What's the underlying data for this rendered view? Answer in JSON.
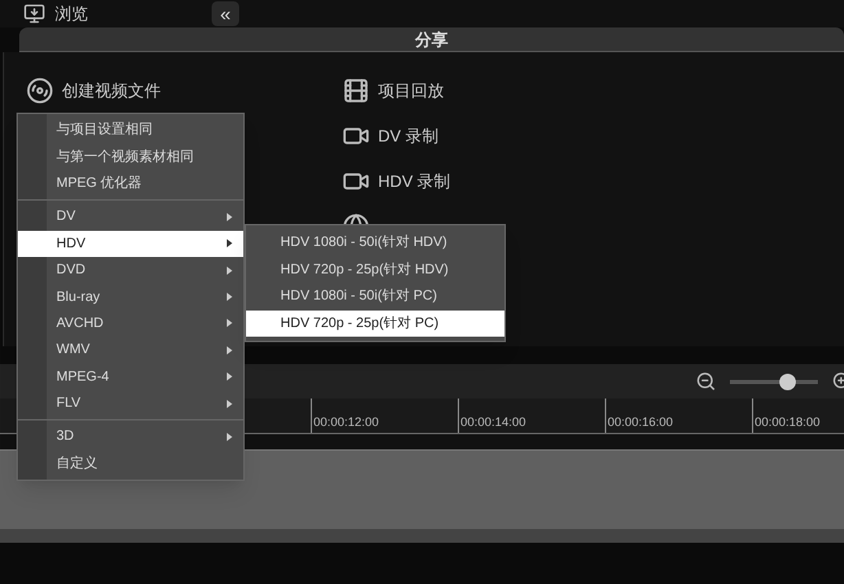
{
  "top_bar": {
    "browse_button": "浏览",
    "collapse_button": "«"
  },
  "share_panel": {
    "title": "分享",
    "items": [
      {
        "label": "创建视频文件",
        "kind": "reel"
      },
      {
        "label": "项目回放",
        "kind": "play"
      },
      {
        "label": "DV 录制",
        "kind": "camera"
      },
      {
        "label": "HDV 录制",
        "kind": "camera"
      },
      {
        "kind": "globe"
      }
    ]
  },
  "context_menu": {
    "groups": [
      [
        {
          "label": "与项目设置相同",
          "has_submenu": false,
          "selected": false
        },
        {
          "label": "与第一个视频素材相同",
          "has_submenu": false,
          "selected": false
        },
        {
          "label": "MPEG 优化器",
          "has_submenu": false,
          "selected": false
        }
      ],
      [
        {
          "label": "DV",
          "has_submenu": true,
          "selected": false
        },
        {
          "label": "HDV",
          "has_submenu": true,
          "selected": true
        },
        {
          "label": "DVD",
          "has_submenu": true,
          "selected": false
        },
        {
          "label": "Blu-ray",
          "has_submenu": true,
          "selected": false
        },
        {
          "label": "AVCHD",
          "has_submenu": true,
          "selected": false
        },
        {
          "label": "WMV",
          "has_submenu": true,
          "selected": false
        },
        {
          "label": "MPEG-4",
          "has_submenu": true,
          "selected": false
        },
        {
          "label": "FLV",
          "has_submenu": true,
          "selected": false
        }
      ],
      [
        {
          "label": "3D",
          "has_submenu": true,
          "selected": false
        },
        {
          "label": "自定义",
          "has_submenu": false,
          "selected": false
        }
      ]
    ]
  },
  "submenu": {
    "items": [
      {
        "label": "HDV 1080i - 50i(针对 HDV)",
        "selected": false
      },
      {
        "label": "HDV 720p - 25p(针对 HDV)",
        "selected": false
      },
      {
        "label": "HDV 1080i - 50i(针对 PC)",
        "selected": false
      },
      {
        "label": "HDV 720p - 25p(针对 PC)",
        "selected": true
      }
    ]
  },
  "timeline": {
    "zoom_slider": {
      "level": 0.7
    },
    "ruler_labels": [
      "00:00:12:00",
      "00:00:14:00",
      "00:00:16:00",
      "00:00:18:00"
    ]
  }
}
